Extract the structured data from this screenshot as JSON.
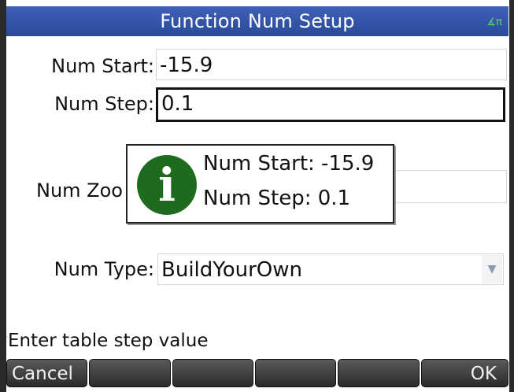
{
  "titlebar": {
    "title": "Function Num Setup",
    "angle_indicator": "∡π"
  },
  "fields": {
    "num_start": {
      "label": "Num Start:",
      "value": "-15.9"
    },
    "num_step": {
      "label": "Num Step:",
      "value": "0.1"
    },
    "num_zoom": {
      "label": "Num Zoo",
      "value": ""
    },
    "num_type": {
      "label": "Num Type:",
      "value": "BuildYourOwn"
    }
  },
  "popup": {
    "icon": "info-icon",
    "line1": "Num Start: -15.9",
    "line2": "Num Step: 0.1"
  },
  "hint": "Enter table step value",
  "softkeys": [
    "Cancel",
    "",
    "",
    "",
    "",
    "OK"
  ],
  "colors": {
    "title_bg": "#2f4fa3",
    "info_icon": "#1e6b1e"
  }
}
